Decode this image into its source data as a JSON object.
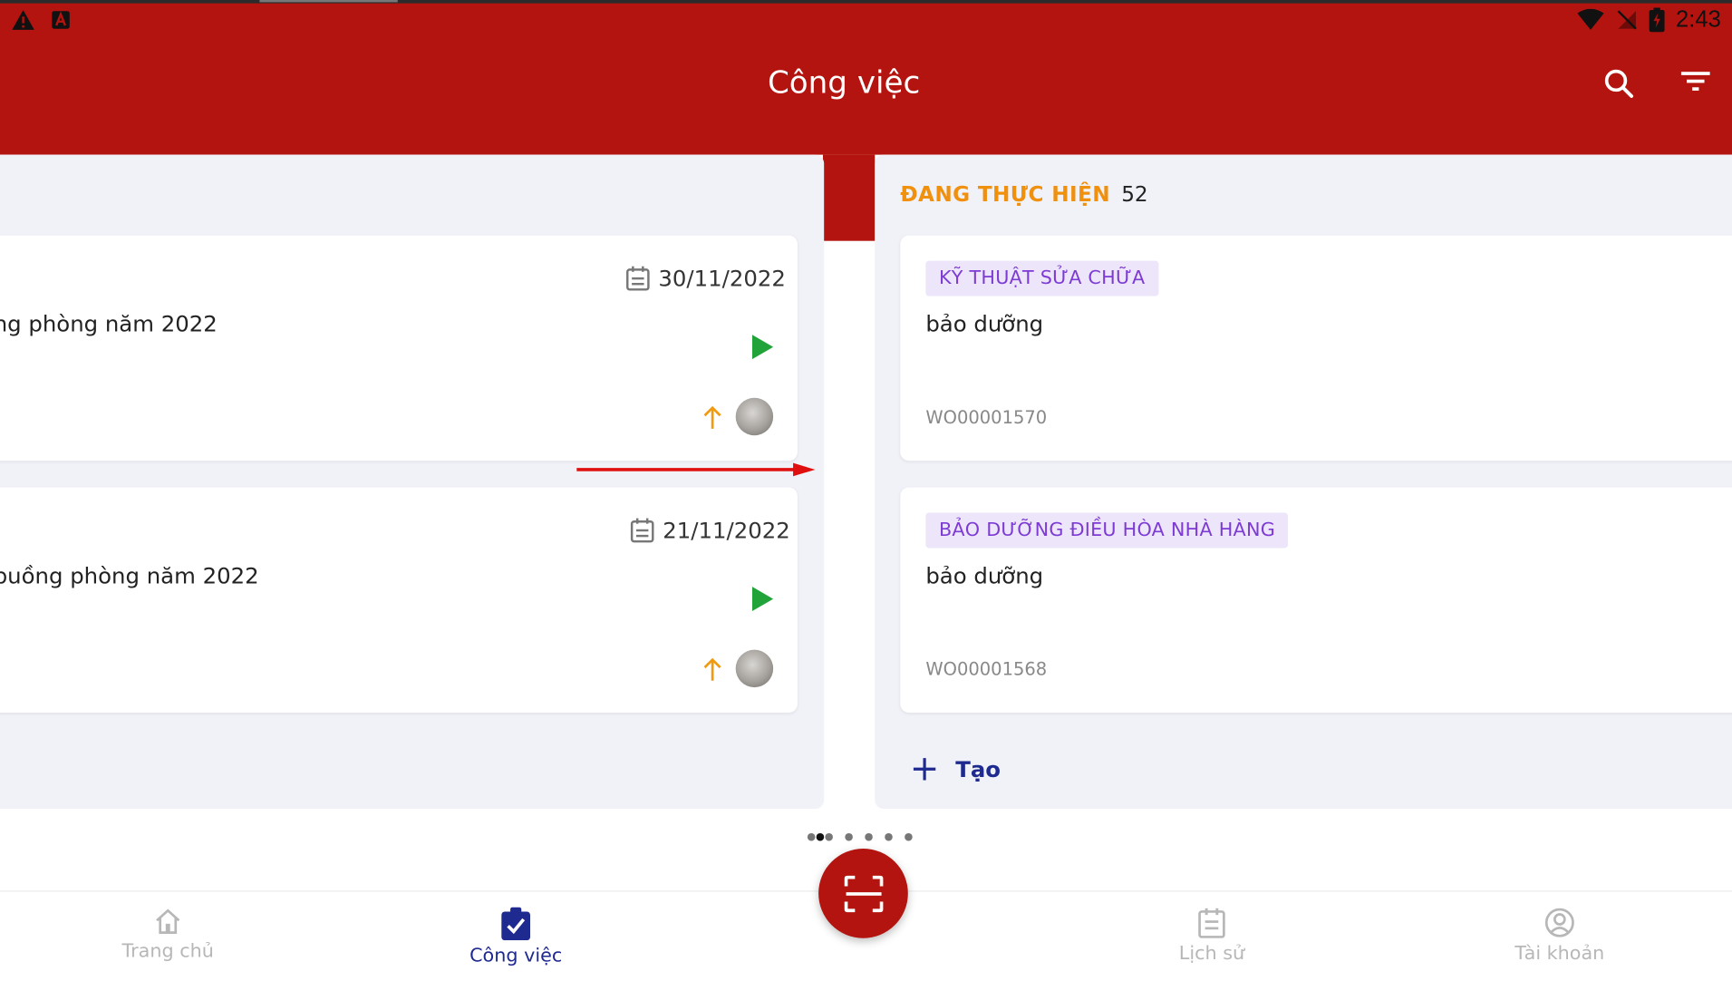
{
  "status_bar": {
    "time": "2:43"
  },
  "header": {
    "title": "Công việc"
  },
  "left_column": {
    "cards": [
      {
        "title": "ng phòng năm 2022",
        "date": "30/11/2022"
      },
      {
        "title": "buồng phòng năm 2022",
        "date": "21/11/2022"
      }
    ]
  },
  "right_column": {
    "title": "ĐANG THỰC HIỆN",
    "count": "52",
    "cards": [
      {
        "tag": "KỸ THUẬT SỬA CHỮA",
        "title": "bảo dưỡng",
        "code": "WO00001570"
      },
      {
        "tag": "BẢO DƯỠNG ĐIỀU HÒA NHÀ HÀNG",
        "title": "bảo dưỡng",
        "code": "WO00001568"
      }
    ],
    "add_label": "Tạo"
  },
  "bottom_nav": {
    "items": [
      {
        "label": "Trang chủ",
        "icon": "home-icon"
      },
      {
        "label": "Công việc",
        "icon": "task-check-icon"
      },
      {
        "label": "Lịch sử",
        "icon": "history-calendar-icon"
      },
      {
        "label": "Tài khoản",
        "icon": "account-icon"
      }
    ],
    "fab_icon": "scan-icon",
    "active_index": 1
  },
  "colors": {
    "header_red": "#b3140f",
    "status_orange": "#f0900f",
    "tag_purple": "#7d3bd4",
    "tag_bg": "#ede6fa",
    "play_green": "#22a33a",
    "priority_orange": "#f09a0f",
    "nav_active": "#1f2a90"
  }
}
